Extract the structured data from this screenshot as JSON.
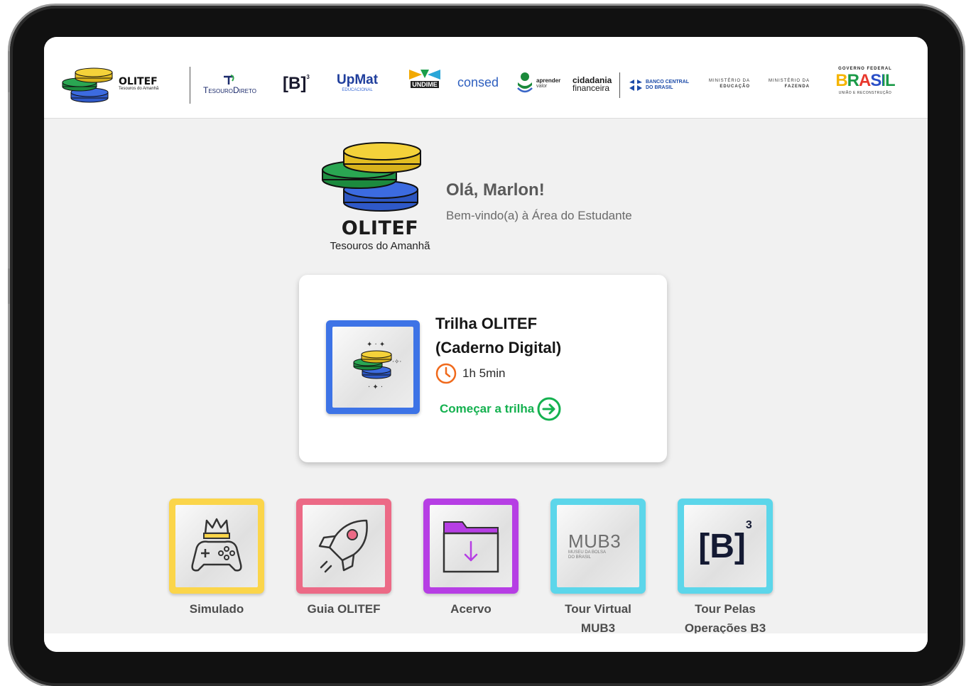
{
  "header": {
    "olitef_name": "OLITEF",
    "olitef_sub": "Tesouros do Amanhã",
    "tesouro_direto": "TesouroDireto",
    "b3": "[B]",
    "b3_sup": "3",
    "upmat": "UpMat",
    "upmat_sub": "EDUCACIONAL",
    "undime": "UNDIME",
    "consed": "consed",
    "aprender": "aprender",
    "aprender_sub": "valor",
    "cidadania": "cidadania",
    "cidadania_sub": "financeira",
    "banco_central_1": "BANCO CENTRAL",
    "banco_central_2": "DO BRASIL",
    "min_educacao_1": "MINISTÉRIO DA",
    "min_educacao_2": "EDUCAÇÃO",
    "min_fazenda_1": "MINISTÉRIO DA",
    "min_fazenda_2": "FAZENDA",
    "governo_federal": "GOVERNO FEDERAL",
    "brasil": "BRASIL",
    "uniao": "UNIÃO E RECONSTRUÇÃO"
  },
  "welcome": {
    "brand_name": "OLITEF",
    "brand_tagline": "Tesouros do Amanhã",
    "greeting": "Olá, Marlon!",
    "subtitle": "Bem-vindo(a) à Área do Estudante"
  },
  "course_card": {
    "title_line1": "Trilha OLITEF",
    "title_line2": "(Caderno Digital)",
    "duration": "1h 5min",
    "cta": "Começar a trilha"
  },
  "tiles": [
    {
      "label_line1": "Simulado",
      "label_line2": "",
      "color": "#fbd54a",
      "icon": "gamepad-crown-icon"
    },
    {
      "label_line1": "Guia OLITEF",
      "label_line2": "",
      "color": "#ec6a86",
      "icon": "rocket-icon"
    },
    {
      "label_line1": "Acervo",
      "label_line2": "",
      "color": "#b63ee4",
      "icon": "folder-download-icon"
    },
    {
      "label_line1": "Tour Virtual",
      "label_line2": "MUB3",
      "color": "#5cd6ea",
      "icon": "mub3-logo",
      "logo_text": "MUB3",
      "logo_sub1": "MUSEU DA BOLSA",
      "logo_sub2": "DO BRASIL"
    },
    {
      "label_line1": "Tour Pelas",
      "label_line2": "Operações B3",
      "color": "#5cd6ea",
      "icon": "b3-logo",
      "logo_text": "[B]",
      "logo_sup": "3"
    }
  ],
  "colors": {
    "accent_green": "#14b14f",
    "clock_orange": "#f06a1c",
    "card_blue": "#3d73e6"
  }
}
